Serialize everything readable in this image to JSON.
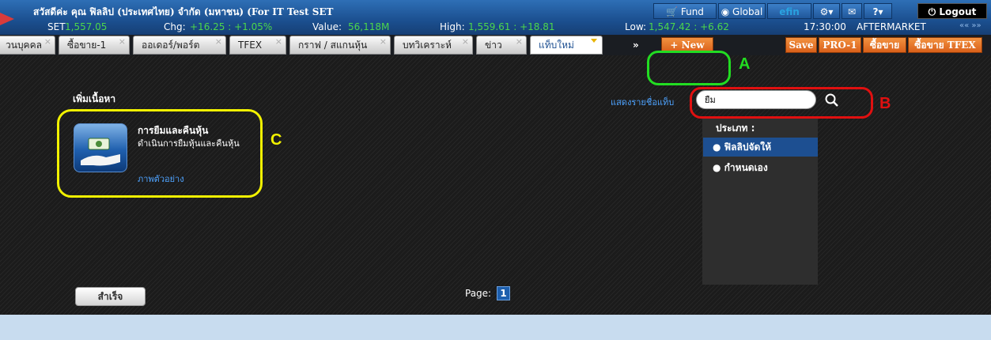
{
  "header": {
    "greeting": "สวัสดีค่ะ คุณ ฟิลลิป (ประเทศไทย) จำกัด (มหาชน) (For IT Test SET",
    "buttons": {
      "fund": "Fund",
      "global": "Global",
      "efin": "efin",
      "logout": "Logout"
    }
  },
  "quote": {
    "set_label": "SET",
    "set_value": "1,557.05",
    "chg_label": "Chg:",
    "chg_value": "+16.25 : +1.05%",
    "value_label": "Value:",
    "value_value": "56,118M",
    "high_label": "High:",
    "high_value": "1,559.61 : +18.81",
    "low_label": "Low:",
    "low_value": "1,547.42 : +6.62",
    "time": "17:30:00",
    "session": "AFTERMARKET",
    "nav": "«« »»"
  },
  "tabs": [
    {
      "label": "วนบุคคล"
    },
    {
      "label": "ซื้อขาย-1"
    },
    {
      "label": "ออเดอร์/พอร์ต"
    },
    {
      "label": "TFEX"
    },
    {
      "label": "กราฟ / สแกนหุ้น"
    },
    {
      "label": "บทวิเคราะห์"
    },
    {
      "label": "ข่าว"
    },
    {
      "label": "แท็บใหม่"
    }
  ],
  "toolbar": {
    "more": "»",
    "new": "+ New",
    "save": "Save",
    "pro": "PRO-1",
    "buysell": "ซื้อขาย",
    "buysell_tfex": "ซื้อขาย TFEX"
  },
  "content": {
    "add_title": "เพิ่มเนื้อหา",
    "card_title": "การยืมและคืนหุ้น",
    "card_desc": "ดำเนินการยืมหุ้นและคืนหุ้น",
    "card_link": "ภาพตัวอย่าง",
    "show_label": "แสดงรายชื่อแท็บ",
    "search_value": "ยืม",
    "filter_title": "ประเภท :",
    "filter_options": [
      "ฟิลลิปจัดให้",
      "กำหนดเอง"
    ],
    "done": "สำเร็จ",
    "page_label": "Page:",
    "page_num": "1"
  },
  "annotations": {
    "a": "A",
    "b": "B",
    "c": "C"
  },
  "colors": {
    "ring_a": "#22dd22",
    "ring_b": "#e01010",
    "ring_c": "#f2f200",
    "orange": "#e8742a",
    "header_blue": "#1b4f8f"
  }
}
